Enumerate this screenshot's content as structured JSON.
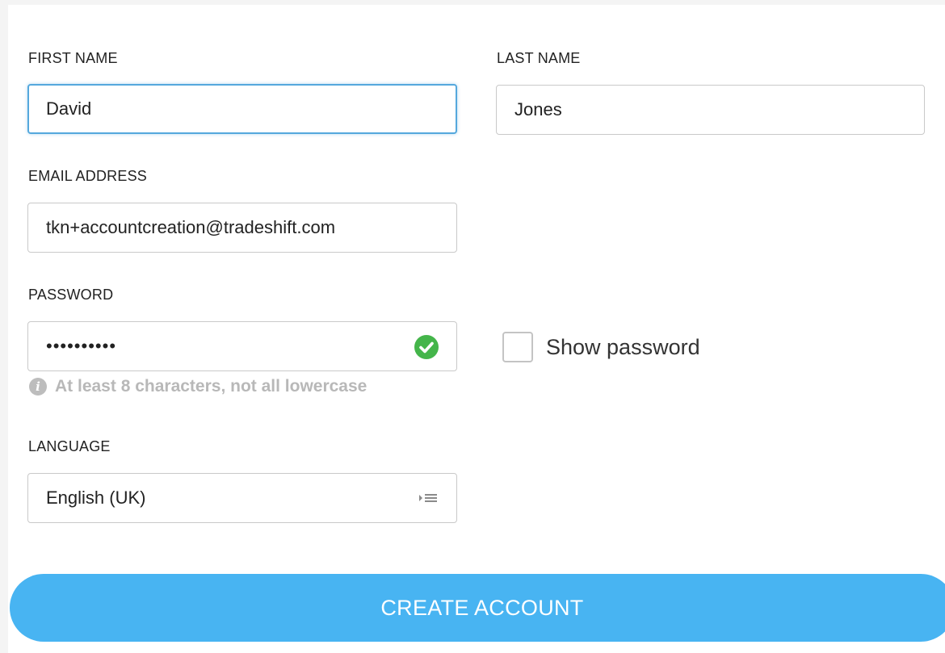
{
  "form": {
    "first_name": {
      "label": "FIRST NAME",
      "value": "David"
    },
    "last_name": {
      "label": "LAST NAME",
      "value": "Jones"
    },
    "email": {
      "label": "EMAIL ADDRESS",
      "value": "tkn+accountcreation@tradeshift.com"
    },
    "password": {
      "label": "PASSWORD",
      "value": "••••••••••",
      "hint": "At least 8 characters, not all lowercase",
      "valid_icon": "check-circle-icon"
    },
    "show_password": {
      "label": "Show password",
      "checked": false
    },
    "language": {
      "label": "LANGUAGE",
      "selected": "English (UK)",
      "icon": "select-list-icon"
    },
    "submit_label": "CREATE ACCOUNT"
  },
  "colors": {
    "accent": "#48b4f2",
    "focus_border": "#55a8dd",
    "valid": "#44b54a",
    "hint": "#b8b8b8"
  }
}
